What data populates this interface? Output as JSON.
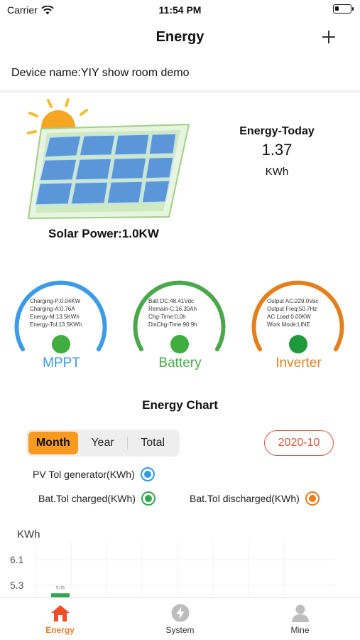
{
  "status": {
    "carrier": "Carrier",
    "time": "11:54 PM"
  },
  "nav": {
    "title": "Energy"
  },
  "device": {
    "label": "Device name:YIY show room demo"
  },
  "solar": {
    "power_label": "Solar Power:1.0KW"
  },
  "energy_today": {
    "label": "Energy-Today",
    "value": "1.37",
    "unit": "KWh"
  },
  "gauges": [
    {
      "name": "MPPT",
      "color": "#3b9be6",
      "dot_color": "#3fae3f",
      "lines": [
        "Charging-P:0.04KW",
        "Charging-A:0.76A",
        "Energy-M:13.5KWh",
        "Energy-Tol:13.5KWh"
      ]
    },
    {
      "name": "Battery",
      "color": "#4aa84a",
      "dot_color": "#3fae3f",
      "lines": [
        "Batt DC:48.41Vdc",
        "Remain-C:16.30Ah",
        "Chg-Time:0.0h",
        "DisChg-Time:90.9h"
      ]
    },
    {
      "name": "Inverter",
      "color": "#e4801c",
      "dot_color": "#1f9a3a",
      "lines": [
        "Output AC:229.0Vac",
        "Output Freq:50.7Hz",
        "AC Load:0.00KW",
        "Work Mode:LINE"
      ]
    }
  ],
  "chart_section": {
    "title": "Energy Chart",
    "tabs": [
      "Month",
      "Year",
      "Total"
    ],
    "active_tab": "Month",
    "date": "2020-10",
    "legend": [
      {
        "label": "PV Tol generator(KWh)",
        "color": "#2f9be6"
      },
      {
        "label": "Bat.Tol charged(KWh)",
        "color": "#2fa84f"
      },
      {
        "label": "Bat.Tol discharged(KWh)",
        "color": "#ee7a1e"
      }
    ]
  },
  "chart_data": {
    "type": "bar",
    "ylabel": "KWh",
    "yticks": [
      "6.1",
      "5.3"
    ],
    "series": [
      {
        "values": [
          5.05
        ],
        "color": "#2fa84f",
        "value_labels": [
          "5.05"
        ]
      }
    ]
  },
  "tabbar": {
    "items": [
      {
        "label": "Energy",
        "icon": "home-icon",
        "active": true
      },
      {
        "label": "System",
        "icon": "bolt-icon",
        "active": false
      },
      {
        "label": "Mine",
        "icon": "person-icon",
        "active": false
      }
    ]
  },
  "colors": {
    "accent": "#f79a1e",
    "date_border": "#e2563e",
    "tab_active": "#f07a2a"
  }
}
